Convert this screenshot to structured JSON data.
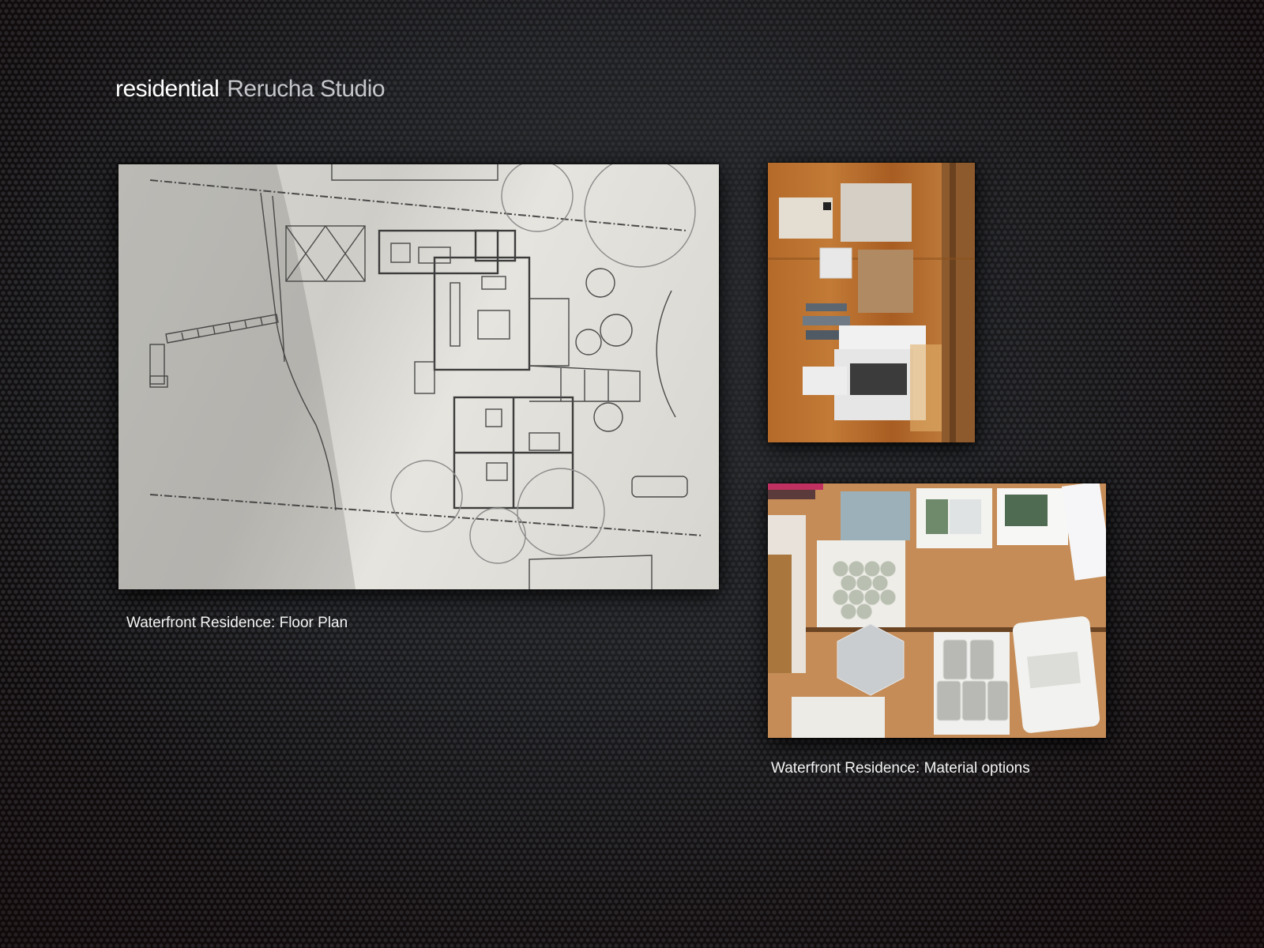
{
  "header": {
    "category": "residential",
    "studio": "Rerucha Studio"
  },
  "gallery": {
    "items": [
      {
        "caption": "Waterfront Residence: Floor Plan",
        "image": "floor-plan-drawing"
      },
      {
        "caption": "",
        "image": "material-swatches-photo"
      },
      {
        "caption": "Waterfront Residence: Material options",
        "image": "tile-samples-photo"
      }
    ]
  },
  "colors": {
    "background": "#1f2023",
    "caption_text": "#f4f4f4",
    "header_primary": "#ffffff",
    "header_secondary": "#c4c6ca"
  }
}
